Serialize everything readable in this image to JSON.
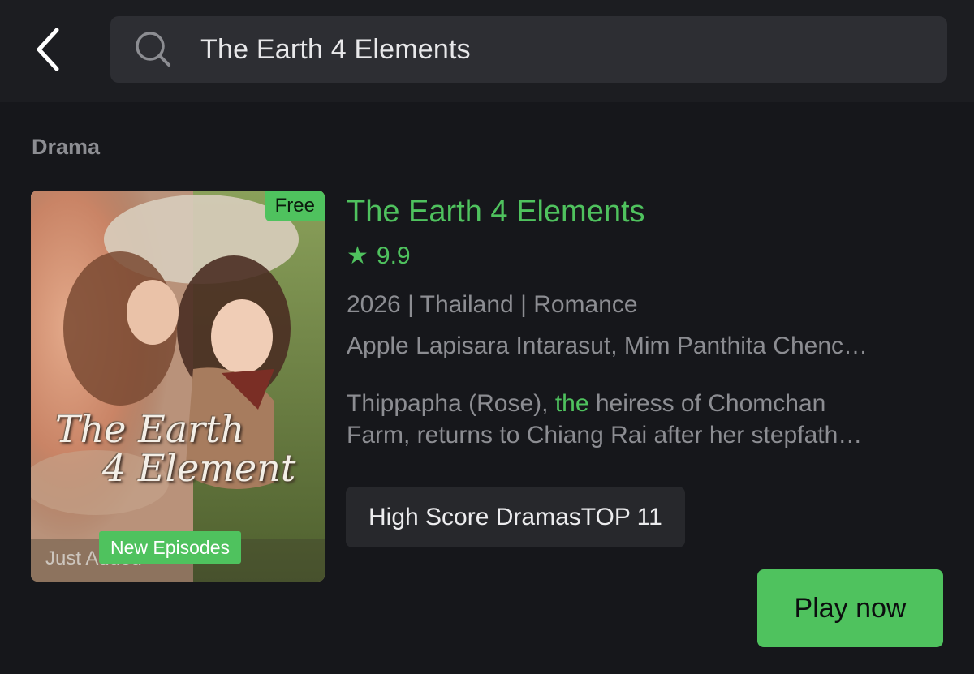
{
  "search": {
    "query": "The Earth 4 Elements"
  },
  "section": {
    "title": "Drama"
  },
  "result": {
    "poster": {
      "free_badge": "Free",
      "title_line1": "The Earth",
      "title_line2": "4 Element",
      "overlay_text": "Just Added",
      "new_badge": "New Episodes"
    },
    "title": "The Earth 4 Elements",
    "rating_star": "★",
    "rating": "9.9",
    "meta": "2026 | Thailand | Romance",
    "cast": "Apple Lapisara Intarasut, Mim Panthita Chenc…",
    "description": {
      "line1_before": "Thippapha (Rose), ",
      "line1_highlight": "the",
      "line1_after": " heiress of Chomchan",
      "line2": "Farm, returns to Chiang Rai after her stepfath…"
    },
    "tag": "High Score DramasTOP 11",
    "play_label": "Play now"
  },
  "colors": {
    "accent": "#4fc25e",
    "background": "#16171b",
    "header": "#1c1d21",
    "search_field": "#2d2e33",
    "muted_text": "#8c8d92"
  }
}
